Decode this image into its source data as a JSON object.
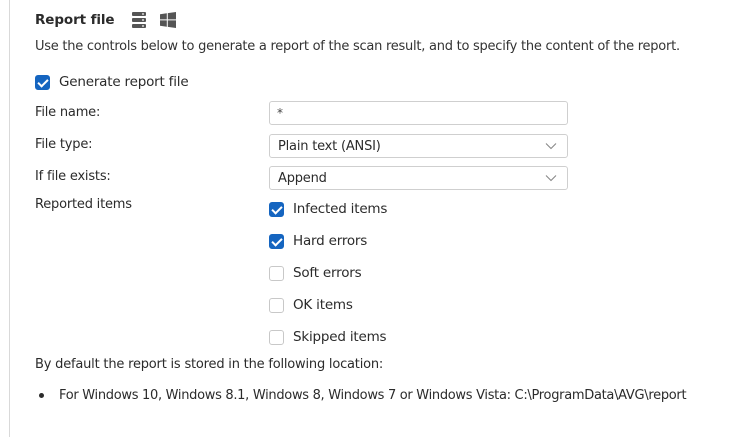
{
  "header": {
    "title": "Report file",
    "icons": [
      "server-icon",
      "windows-icon"
    ]
  },
  "description": "Use the controls below to generate a report of the scan result, and to specify the content of the report.",
  "generate_report": {
    "label": "Generate report file",
    "checked": true
  },
  "fields": {
    "file_name": {
      "label": "File name:",
      "value": "*"
    },
    "file_type": {
      "label": "File type:",
      "value": "Plain text (ANSI)"
    },
    "if_exists": {
      "label": "If file exists:",
      "value": "Append"
    }
  },
  "reported_items": {
    "label": "Reported items",
    "options": [
      {
        "label": "Infected items",
        "checked": true
      },
      {
        "label": "Hard errors",
        "checked": true
      },
      {
        "label": "Soft errors",
        "checked": false
      },
      {
        "label": "OK items",
        "checked": false
      },
      {
        "label": "Skipped items",
        "checked": false
      }
    ]
  },
  "default_location": {
    "note": "By default the report is stored in the following location:",
    "bullets": [
      "For Windows 10, Windows 8.1, Windows 8, Windows 7 or Windows Vista: C:\\ProgramData\\AVG\\report"
    ]
  },
  "colors": {
    "accent": "#1565c0",
    "border": "#cfcfcf",
    "text": "#2b2b2b"
  }
}
